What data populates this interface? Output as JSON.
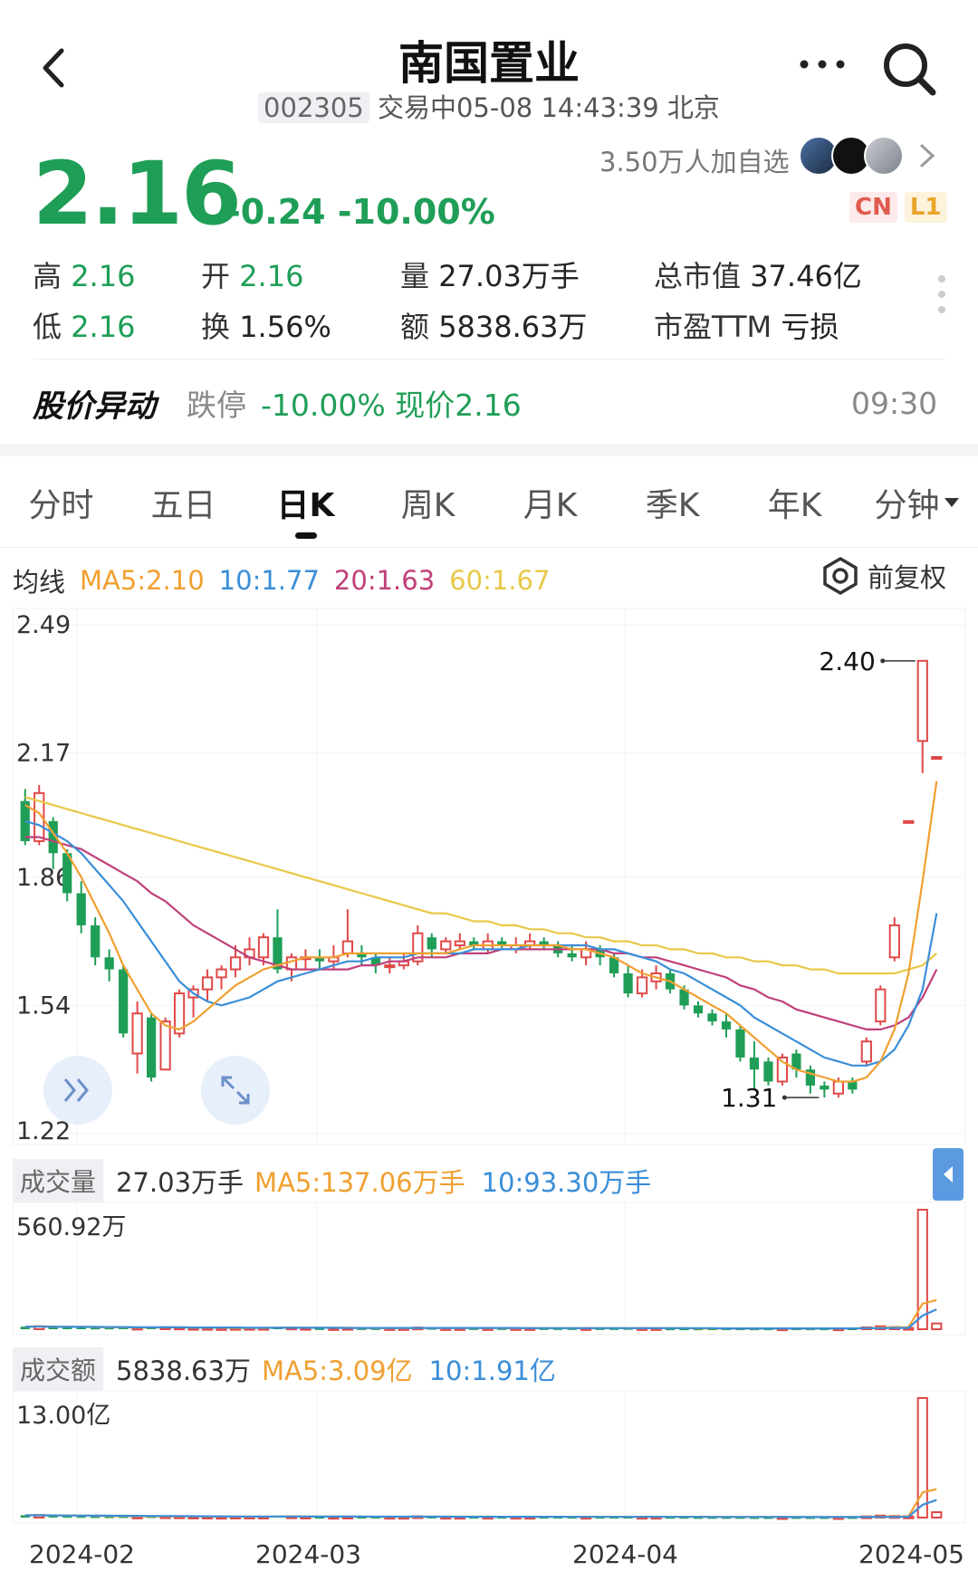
{
  "header": {
    "title": "南国置业",
    "code": "002305",
    "status": "交易中05-08 14:43:39 北京"
  },
  "quote": {
    "price": "2.16",
    "change": "-0.24 -10.00%",
    "watchers": "3.50万人加自选",
    "badge_cn": "CN",
    "badge_l1": "L1",
    "high_label": "高",
    "high": "2.16",
    "low_label": "低",
    "low": "2.16",
    "open_label": "开",
    "open": "2.16",
    "turnover_label": "换",
    "turnover": "1.56%",
    "volume_label": "量",
    "volume": "27.03万手",
    "amount_label": "额",
    "amount": "5838.63万",
    "mktcap_label": "总市值",
    "mktcap": "37.46亿",
    "pe_label": "市盈TTM",
    "pe": "亏损"
  },
  "alert": {
    "title": "股价异动",
    "type": "跌停",
    "detail": "-10.00% 现价2.16",
    "time": "09:30"
  },
  "tabs": [
    "分时",
    "五日",
    "日K",
    "周K",
    "月K",
    "季K",
    "年K",
    "分钟"
  ],
  "active_tab": 2,
  "ma_bar": {
    "label": "均线",
    "ma5": "MA5:2.10",
    "ma10": "10:1.77",
    "ma20": "20:1.63",
    "ma60": "60:1.67",
    "adjust": "前复权"
  },
  "volume_bar": {
    "label": "成交量",
    "value": "27.03万手",
    "ma5": "MA5:137.06万手",
    "ma10": "10:93.30万手",
    "max": "560.92万"
  },
  "amount_bar": {
    "label": "成交额",
    "value": "5838.63万",
    "ma5": "MA5:3.09亿",
    "ma10": "10:1.91亿",
    "max": "13.00亿"
  },
  "colors": {
    "down": "#1f9e57",
    "up": "#e04848",
    "ma5": "#f0a030",
    "ma10": "#3a8ed8",
    "ma20": "#c0407a",
    "ma60": "#e8c848"
  },
  "chart_data": {
    "type": "candlestick",
    "y_ticks": [
      "2.49",
      "2.17",
      "1.86",
      "1.54",
      "1.22"
    ],
    "ylim": [
      1.22,
      2.49
    ],
    "x_labels": [
      "2024-02",
      "2024-03",
      "2024-04",
      "2024-05"
    ],
    "max_label": "2.40",
    "min_label": "1.31",
    "candles": [
      [
        2.05,
        1.95,
        2.08,
        1.94
      ],
      [
        1.95,
        2.07,
        2.09,
        1.94
      ],
      [
        2.0,
        1.92,
        2.01,
        1.88
      ],
      [
        1.92,
        1.82,
        1.93,
        1.8
      ],
      [
        1.82,
        1.74,
        1.85,
        1.72
      ],
      [
        1.74,
        1.66,
        1.76,
        1.64
      ],
      [
        1.66,
        1.63,
        1.68,
        1.6
      ],
      [
        1.63,
        1.47,
        1.64,
        1.46
      ],
      [
        1.42,
        1.52,
        1.55,
        1.37
      ],
      [
        1.51,
        1.36,
        1.52,
        1.35
      ],
      [
        1.38,
        1.5,
        1.51,
        1.38
      ],
      [
        1.47,
        1.57,
        1.58,
        1.46
      ],
      [
        1.56,
        1.58,
        1.59,
        1.51
      ],
      [
        1.58,
        1.61,
        1.63,
        1.55
      ],
      [
        1.61,
        1.63,
        1.64,
        1.58
      ],
      [
        1.63,
        1.66,
        1.69,
        1.61
      ],
      [
        1.66,
        1.68,
        1.71,
        1.64
      ],
      [
        1.66,
        1.71,
        1.72,
        1.64
      ],
      [
        1.71,
        1.63,
        1.78,
        1.62
      ],
      [
        1.63,
        1.66,
        1.67,
        1.6
      ],
      [
        1.66,
        1.66,
        1.68,
        1.63
      ],
      [
        1.66,
        1.65,
        1.68,
        1.63
      ],
      [
        1.65,
        1.66,
        1.69,
        1.63
      ],
      [
        1.67,
        1.7,
        1.78,
        1.66
      ],
      [
        1.67,
        1.66,
        1.69,
        1.64
      ],
      [
        1.66,
        1.64,
        1.67,
        1.62
      ],
      [
        1.64,
        1.64,
        1.66,
        1.62
      ],
      [
        1.64,
        1.65,
        1.67,
        1.63
      ],
      [
        1.65,
        1.72,
        1.74,
        1.64
      ],
      [
        1.71,
        1.68,
        1.72,
        1.66
      ],
      [
        1.68,
        1.7,
        1.71,
        1.67
      ],
      [
        1.69,
        1.7,
        1.72,
        1.68
      ],
      [
        1.7,
        1.69,
        1.71,
        1.68
      ],
      [
        1.68,
        1.7,
        1.72,
        1.67
      ],
      [
        1.7,
        1.69,
        1.71,
        1.68
      ],
      [
        1.68,
        1.69,
        1.71,
        1.67
      ],
      [
        1.69,
        1.7,
        1.72,
        1.68
      ],
      [
        1.7,
        1.69,
        1.71,
        1.68
      ],
      [
        1.69,
        1.67,
        1.7,
        1.66
      ],
      [
        1.67,
        1.66,
        1.69,
        1.65
      ],
      [
        1.66,
        1.68,
        1.7,
        1.64
      ],
      [
        1.68,
        1.66,
        1.69,
        1.64
      ],
      [
        1.66,
        1.62,
        1.67,
        1.61
      ],
      [
        1.62,
        1.57,
        1.64,
        1.56
      ],
      [
        1.57,
        1.61,
        1.63,
        1.56
      ],
      [
        1.6,
        1.62,
        1.64,
        1.58
      ],
      [
        1.62,
        1.58,
        1.63,
        1.57
      ],
      [
        1.58,
        1.54,
        1.59,
        1.53
      ],
      [
        1.54,
        1.52,
        1.55,
        1.51
      ],
      [
        1.52,
        1.5,
        1.53,
        1.49
      ],
      [
        1.5,
        1.48,
        1.52,
        1.46
      ],
      [
        1.48,
        1.41,
        1.49,
        1.4
      ],
      [
        1.41,
        1.38,
        1.45,
        1.33
      ],
      [
        1.4,
        1.35,
        1.41,
        1.34
      ],
      [
        1.35,
        1.41,
        1.42,
        1.34
      ],
      [
        1.42,
        1.38,
        1.43,
        1.36
      ],
      [
        1.38,
        1.34,
        1.39,
        1.32
      ],
      [
        1.34,
        1.33,
        1.35,
        1.31
      ],
      [
        1.32,
        1.35,
        1.36,
        1.31
      ],
      [
        1.35,
        1.33,
        1.36,
        1.32
      ],
      [
        1.4,
        1.45,
        1.46,
        1.39
      ],
      [
        1.5,
        1.58,
        1.59,
        1.49
      ],
      [
        1.66,
        1.74,
        1.76,
        1.65
      ],
      [
        2.0,
        2.0,
        2.0,
        2.0
      ],
      [
        2.2,
        2.4,
        2.4,
        2.12
      ],
      [
        2.16,
        2.16,
        2.16,
        2.16
      ]
    ],
    "ma5": [
      2.04,
      2.02,
      1.97,
      1.92,
      1.86,
      1.79,
      1.72,
      1.64,
      1.58,
      1.52,
      1.49,
      1.48,
      1.5,
      1.53,
      1.56,
      1.59,
      1.61,
      1.63,
      1.64,
      1.65,
      1.66,
      1.66,
      1.66,
      1.67,
      1.67,
      1.67,
      1.67,
      1.67,
      1.67,
      1.67,
      1.67,
      1.68,
      1.69,
      1.69,
      1.69,
      1.69,
      1.69,
      1.69,
      1.69,
      1.68,
      1.68,
      1.67,
      1.66,
      1.64,
      1.62,
      1.61,
      1.6,
      1.58,
      1.56,
      1.54,
      1.52,
      1.49,
      1.46,
      1.43,
      1.4,
      1.38,
      1.37,
      1.36,
      1.35,
      1.35,
      1.36,
      1.4,
      1.48,
      1.62,
      1.85,
      2.1
    ],
    "ma10": [
      2.0,
      1.99,
      1.97,
      1.95,
      1.92,
      1.88,
      1.84,
      1.8,
      1.75,
      1.7,
      1.65,
      1.6,
      1.57,
      1.55,
      1.54,
      1.55,
      1.56,
      1.58,
      1.6,
      1.61,
      1.62,
      1.63,
      1.64,
      1.65,
      1.65,
      1.66,
      1.66,
      1.66,
      1.67,
      1.67,
      1.67,
      1.67,
      1.68,
      1.68,
      1.68,
      1.68,
      1.69,
      1.69,
      1.69,
      1.69,
      1.69,
      1.68,
      1.68,
      1.67,
      1.66,
      1.65,
      1.63,
      1.62,
      1.6,
      1.58,
      1.56,
      1.54,
      1.51,
      1.49,
      1.47,
      1.45,
      1.43,
      1.41,
      1.4,
      1.39,
      1.39,
      1.4,
      1.43,
      1.49,
      1.58,
      1.77
    ],
    "ma20": [
      1.96,
      1.96,
      1.95,
      1.94,
      1.93,
      1.91,
      1.89,
      1.87,
      1.85,
      1.82,
      1.8,
      1.77,
      1.74,
      1.72,
      1.7,
      1.68,
      1.66,
      1.65,
      1.64,
      1.63,
      1.63,
      1.63,
      1.63,
      1.63,
      1.64,
      1.64,
      1.65,
      1.65,
      1.66,
      1.66,
      1.66,
      1.67,
      1.67,
      1.67,
      1.68,
      1.68,
      1.68,
      1.68,
      1.68,
      1.68,
      1.68,
      1.68,
      1.67,
      1.67,
      1.66,
      1.66,
      1.65,
      1.64,
      1.63,
      1.62,
      1.61,
      1.59,
      1.58,
      1.56,
      1.55,
      1.53,
      1.52,
      1.51,
      1.5,
      1.49,
      1.48,
      1.48,
      1.49,
      1.51,
      1.56,
      1.63
    ],
    "ma60": [
      2.06,
      2.05,
      2.04,
      2.03,
      2.02,
      2.01,
      2.0,
      1.99,
      1.98,
      1.97,
      1.96,
      1.95,
      1.94,
      1.93,
      1.92,
      1.91,
      1.9,
      1.89,
      1.88,
      1.87,
      1.86,
      1.85,
      1.84,
      1.83,
      1.82,
      1.81,
      1.8,
      1.79,
      1.78,
      1.77,
      1.77,
      1.76,
      1.75,
      1.75,
      1.74,
      1.74,
      1.73,
      1.73,
      1.72,
      1.72,
      1.71,
      1.71,
      1.7,
      1.7,
      1.69,
      1.69,
      1.68,
      1.68,
      1.67,
      1.67,
      1.66,
      1.66,
      1.65,
      1.65,
      1.64,
      1.64,
      1.63,
      1.63,
      1.62,
      1.62,
      1.62,
      1.62,
      1.62,
      1.63,
      1.64,
      1.67
    ],
    "volume": [
      12,
      14,
      10,
      9,
      9,
      8,
      8,
      9,
      7,
      10,
      9,
      8,
      6,
      6,
      5,
      6,
      6,
      6,
      11,
      8,
      6,
      5,
      5,
      6,
      5,
      5,
      5,
      5,
      8,
      6,
      5,
      5,
      5,
      5,
      5,
      5,
      5,
      5,
      5,
      5,
      5,
      5,
      5,
      6,
      5,
      5,
      4,
      4,
      4,
      4,
      4,
      4,
      4,
      4,
      4,
      4,
      4,
      4,
      4,
      4,
      9,
      14,
      10,
      6,
      560.92,
      27.03
    ],
    "volume_ma5": [
      12,
      13,
      12,
      11,
      11,
      10,
      9,
      9,
      8,
      8,
      9,
      9,
      8,
      8,
      7,
      6,
      6,
      6,
      7,
      7,
      7,
      7,
      7,
      7,
      6,
      5,
      5,
      5,
      6,
      6,
      6,
      6,
      6,
      6,
      5,
      5,
      5,
      5,
      5,
      5,
      5,
      5,
      5,
      5,
      5,
      5,
      5,
      5,
      4,
      4,
      4,
      4,
      4,
      4,
      4,
      4,
      4,
      4,
      4,
      4,
      5,
      7,
      9,
      9,
      120,
      137
    ],
    "volume_ma10": [
      12,
      12,
      12,
      11,
      11,
      11,
      10,
      10,
      9,
      9,
      9,
      9,
      8,
      8,
      8,
      8,
      7,
      7,
      7,
      7,
      7,
      7,
      7,
      6,
      6,
      6,
      6,
      6,
      6,
      6,
      6,
      6,
      6,
      6,
      6,
      6,
      5,
      5,
      5,
      5,
      5,
      5,
      5,
      5,
      5,
      5,
      5,
      5,
      5,
      5,
      4,
      4,
      4,
      4,
      4,
      4,
      4,
      4,
      4,
      4,
      5,
      5,
      6,
      6,
      64,
      93
    ],
    "amount": [
      0.25,
      0.28,
      0.2,
      0.18,
      0.17,
      0.15,
      0.14,
      0.15,
      0.11,
      0.15,
      0.14,
      0.13,
      0.1,
      0.1,
      0.08,
      0.1,
      0.1,
      0.1,
      0.19,
      0.13,
      0.1,
      0.08,
      0.08,
      0.1,
      0.08,
      0.08,
      0.08,
      0.08,
      0.14,
      0.1,
      0.08,
      0.08,
      0.08,
      0.08,
      0.08,
      0.08,
      0.08,
      0.08,
      0.08,
      0.08,
      0.08,
      0.08,
      0.08,
      0.09,
      0.08,
      0.08,
      0.07,
      0.07,
      0.06,
      0.06,
      0.06,
      0.06,
      0.05,
      0.05,
      0.05,
      0.05,
      0.05,
      0.05,
      0.05,
      0.05,
      0.13,
      0.22,
      0.17,
      0.12,
      13.0,
      0.58
    ],
    "amount_ma5": [
      0.25,
      0.26,
      0.24,
      0.23,
      0.22,
      0.2,
      0.17,
      0.16,
      0.14,
      0.14,
      0.14,
      0.14,
      0.13,
      0.12,
      0.11,
      0.1,
      0.1,
      0.1,
      0.11,
      0.12,
      0.12,
      0.12,
      0.12,
      0.12,
      0.1,
      0.08,
      0.08,
      0.08,
      0.09,
      0.1,
      0.1,
      0.1,
      0.1,
      0.1,
      0.08,
      0.08,
      0.08,
      0.08,
      0.08,
      0.08,
      0.08,
      0.08,
      0.08,
      0.08,
      0.08,
      0.08,
      0.08,
      0.08,
      0.08,
      0.07,
      0.06,
      0.06,
      0.06,
      0.06,
      0.06,
      0.05,
      0.05,
      0.05,
      0.05,
      0.05,
      0.07,
      0.1,
      0.12,
      0.14,
      2.73,
      3.09
    ],
    "amount_ma10": [
      0.25,
      0.25,
      0.24,
      0.23,
      0.22,
      0.22,
      0.21,
      0.2,
      0.19,
      0.18,
      0.17,
      0.16,
      0.15,
      0.14,
      0.13,
      0.12,
      0.12,
      0.11,
      0.12,
      0.12,
      0.12,
      0.11,
      0.11,
      0.11,
      0.11,
      0.1,
      0.1,
      0.1,
      0.1,
      0.1,
      0.1,
      0.09,
      0.09,
      0.09,
      0.09,
      0.09,
      0.09,
      0.09,
      0.09,
      0.08,
      0.08,
      0.08,
      0.08,
      0.08,
      0.08,
      0.08,
      0.08,
      0.08,
      0.08,
      0.07,
      0.07,
      0.07,
      0.07,
      0.07,
      0.06,
      0.06,
      0.06,
      0.06,
      0.06,
      0.06,
      0.06,
      0.07,
      0.08,
      0.09,
      1.39,
      1.91
    ]
  }
}
